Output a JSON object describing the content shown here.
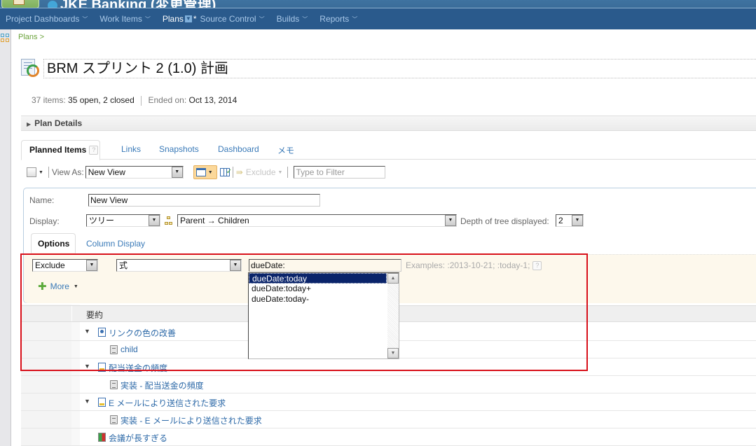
{
  "app": {
    "project_title": "JKE Banking (変更管理)"
  },
  "nav": {
    "items": [
      {
        "label": "Project Dashboards",
        "active": false
      },
      {
        "label": "Work Items",
        "active": false
      },
      {
        "label": "Plans",
        "active": true
      },
      {
        "label": "Source Control",
        "active": false
      },
      {
        "label": "Builds",
        "active": false
      },
      {
        "label": "Reports",
        "active": false
      }
    ],
    "active_marker": "*"
  },
  "breadcrumb": "Plans >",
  "plan": {
    "title": "BRM スプリント 2 (1.0) 計画",
    "items_label": "37 items:",
    "items_value": "35 open, 2 closed",
    "ended_label": "Ended on:",
    "ended_value": "Oct 13, 2014",
    "details_label": "Plan Details"
  },
  "tabs": [
    {
      "label": "Planned Items",
      "active": true
    },
    {
      "label": "Links"
    },
    {
      "label": "Snapshots"
    },
    {
      "label": "Dashboard"
    },
    {
      "label": "メモ"
    }
  ],
  "help_glyph": "?",
  "toolbar": {
    "view_as_label": "View As:",
    "view_as_value": "New View",
    "exclude_label": "Exclude",
    "filter_placeholder": "Type to Filter"
  },
  "view_editor": {
    "name_label": "Name:",
    "name_value": "New View",
    "display_label": "Display:",
    "display_value": "ツリー",
    "hierarchy_value": "Parent → Children",
    "depth_label": "Depth of tree displayed:",
    "depth_value": "2",
    "subtabs": [
      {
        "label": "Options",
        "active": true
      },
      {
        "label": "Column Display"
      }
    ],
    "filter_mode": "Exclude",
    "filter_type": "式",
    "expression_value": "dueDate:",
    "examples": "Examples: :2013-10-21; :today-1;",
    "more_label": "More"
  },
  "autocomplete": {
    "options": [
      {
        "label": "dueDate:today",
        "selected": true
      },
      {
        "label": "dueDate:today+",
        "selected": false
      },
      {
        "label": "dueDate:today-",
        "selected": false
      }
    ]
  },
  "grid": {
    "header": "要約",
    "rows": [
      {
        "title": "リンクの色の改善",
        "type": "story-icon",
        "level": 0,
        "expanded": true
      },
      {
        "title": "child",
        "type": "task-icon",
        "level": 1,
        "expanded": false
      },
      {
        "title": "配当送金の頻度",
        "type": "requirement-icon",
        "level": 0,
        "expanded": true
      },
      {
        "title": "実装 - 配当送金の頻度",
        "type": "task-icon",
        "level": 1,
        "expanded": false
      },
      {
        "title": "E メールにより送信された要求",
        "type": "requirement-icon",
        "level": 0,
        "expanded": true
      },
      {
        "title": "実装 - E メールにより送信された要求",
        "type": "task-icon",
        "level": 1,
        "expanded": false
      },
      {
        "title": "会議が長すぎる",
        "type": "impediment-icon",
        "level": 0,
        "expanded": false
      }
    ]
  },
  "colors": {
    "nav_bg": "#2a5a8c",
    "link": "#2e6aa8",
    "highlight_box": "#d8101a",
    "selected_option": "#0a246a"
  }
}
